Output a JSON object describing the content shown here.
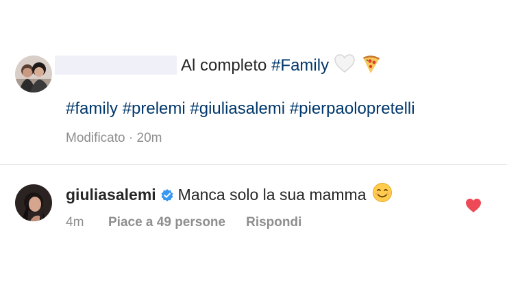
{
  "caption": {
    "text": "Al completo",
    "hashtag_inline": "#Family",
    "emojis": [
      "white-heart-icon",
      "pizza-icon"
    ],
    "hashtags": "#family #prelemi #giuliasalemi #pierpaolopretelli",
    "edited_label": "Modificato",
    "separator": "·",
    "time": "20m"
  },
  "comment": {
    "username": "giuliasalemi",
    "text": "Manca solo la sua mamma",
    "emoji": "smiling-face-icon",
    "time": "4m",
    "likes_label": "Piace a 49 persone",
    "reply_label": "Rispondi",
    "liked": true
  },
  "colors": {
    "hashtag": "#00376b",
    "text": "#262626",
    "secondary": "#8e8e8e",
    "divider": "#dbdbdb",
    "verified": "#3897f0",
    "like_heart": "#ed4956",
    "redaction": "#f0f1f8"
  }
}
